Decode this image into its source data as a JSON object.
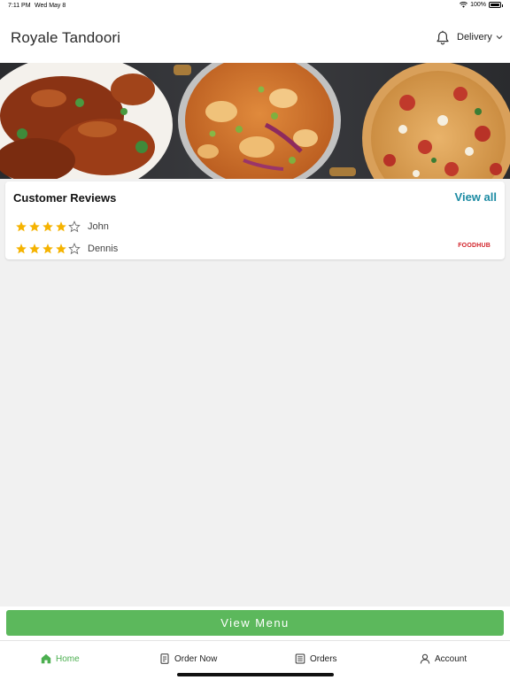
{
  "status_bar": {
    "time": "7:11 PM",
    "date": "Wed May 8",
    "battery_percent": "100%"
  },
  "header": {
    "title": "Royale Tandoori",
    "mode_label": "Delivery"
  },
  "reviews": {
    "heading": "Customer Reviews",
    "view_all_label": "View all",
    "items": [
      {
        "name": "John",
        "rating": 4,
        "max": 5
      },
      {
        "name": "Dennis",
        "rating": 4,
        "max": 5
      }
    ],
    "brand": "FOODHUB"
  },
  "cta": {
    "label": "View Menu"
  },
  "tabs": [
    {
      "label": "Home",
      "icon": "home-icon",
      "active": true
    },
    {
      "label": "Order Now",
      "icon": "order-icon",
      "active": false
    },
    {
      "label": "Orders",
      "icon": "orders-icon",
      "active": false
    },
    {
      "label": "Account",
      "icon": "account-icon",
      "active": false
    }
  ],
  "colors": {
    "accent_green": "#5cb85c",
    "link_blue": "#1c8ba3",
    "star_gold": "#f5b301",
    "brand_red": "#d2232a"
  }
}
